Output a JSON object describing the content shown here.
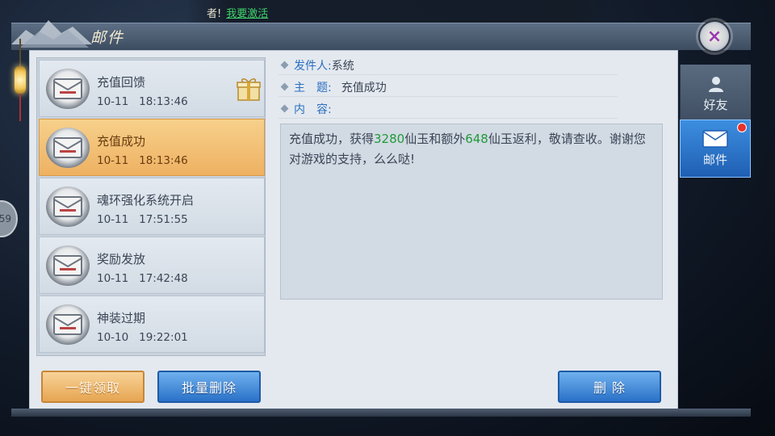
{
  "banner": {
    "prefix": "者!",
    "link": "我要激活"
  },
  "side_bubble": "59",
  "window": {
    "title": "邮件",
    "close_label": "×"
  },
  "mail_list": [
    {
      "subject": "充值回馈",
      "date": "10-11",
      "time": "18:13:46",
      "has_gift": true,
      "selected": false
    },
    {
      "subject": "充值成功",
      "date": "10-11",
      "time": "18:13:46",
      "has_gift": false,
      "selected": true
    },
    {
      "subject": "魂环强化系统开启",
      "date": "10-11",
      "time": "17:51:55",
      "has_gift": false,
      "selected": false
    },
    {
      "subject": "奖励发放",
      "date": "10-11",
      "time": "17:42:48",
      "has_gift": false,
      "selected": false
    },
    {
      "subject": "神装过期",
      "date": "10-10",
      "time": "19:22:01",
      "has_gift": false,
      "selected": false
    }
  ],
  "buttons": {
    "claim_all": "一键领取",
    "batch_delete": "批量删除",
    "delete": "删 除"
  },
  "detail": {
    "sender_label": "发件人:",
    "sender_value": "系统",
    "subject_label": "主　题:",
    "subject_value": "充值成功",
    "content_label": "内　容:",
    "content_parts": [
      "充值成功，获得",
      "3280",
      "仙玉和额外",
      "648",
      "仙玉返利，敬请查收。谢谢您对游戏的支持，么么哒!"
    ]
  },
  "tabs": [
    {
      "label": "好友",
      "icon": "friend-icon",
      "active": false
    },
    {
      "label": "邮件",
      "icon": "mail-icon",
      "active": true
    }
  ],
  "colors": {
    "accent_blue": "#2a72c8",
    "accent_orange": "#e6a552",
    "highlight_green": "#1f9a3a",
    "label_blue": "#2a6fc0",
    "badge_red": "#e8322c"
  }
}
